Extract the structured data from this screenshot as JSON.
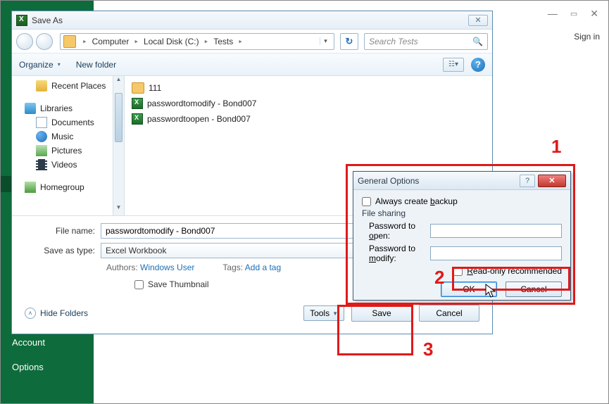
{
  "window_controls": {
    "signin": "Sign in"
  },
  "greenbar": {
    "account": "Account",
    "options": "Options"
  },
  "saveas": {
    "title": "Save As",
    "breadcrumb": {
      "root": "Computer",
      "drive": "Local Disk (C:)",
      "folder": "Tests"
    },
    "search_placeholder": "Search Tests",
    "toolbar": {
      "organize": "Organize",
      "newfolder": "New folder"
    },
    "tree": {
      "recent": "Recent Places",
      "libraries": "Libraries",
      "documents": "Documents",
      "music": "Music",
      "pictures": "Pictures",
      "videos": "Videos",
      "homegroup": "Homegroup"
    },
    "files": {
      "folder0": "111",
      "file1": "passwordtomodify - Bond007",
      "file2": "passwordtoopen - Bond007"
    },
    "form": {
      "filename_label": "File name:",
      "filename_value": "passwordtomodify - Bond007",
      "type_label": "Save as type:",
      "type_value": "Excel Workbook",
      "authors_label": "Authors:",
      "authors_value": "Windows User",
      "tags_label": "Tags:",
      "tags_value": "Add a tag",
      "savethumb": "Save Thumbnail"
    },
    "footer": {
      "hide": "Hide Folders",
      "tools": "Tools",
      "save": "Save",
      "cancel": "Cancel"
    }
  },
  "genopt": {
    "title": "General Options",
    "backup": "Always create backup",
    "filesharing": "File sharing",
    "pw_open": "Password to open:",
    "pw_modify": "Password to modify:",
    "readonly": "Read-only recommended",
    "ok": "OK",
    "cancel": "Cancel"
  },
  "annotations": {
    "n1": "1",
    "n2": "2",
    "n3": "3"
  }
}
